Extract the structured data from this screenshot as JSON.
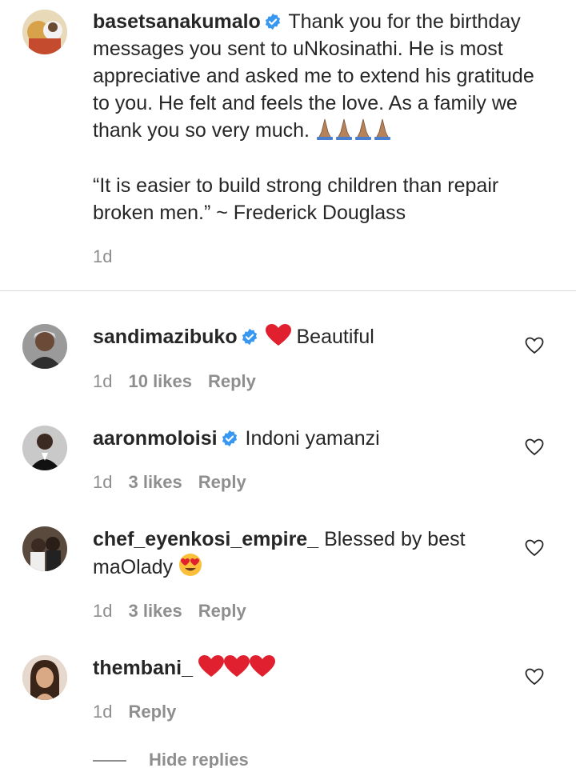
{
  "caption": {
    "username": "basetsanakumalo",
    "verified": true,
    "text": "Thank you for the birthday messages you sent to uNkosinathi. He is most appreciative and asked me to extend his gratitude to you. He felt and feels the love. As a family we thank you so very much.",
    "emoji": "praying-hands x4",
    "quote": "“It is easier to build strong children than repair broken men.” ~ Frederick Douglass",
    "time": "1d"
  },
  "comments": [
    {
      "username": "sandimazibuko",
      "verified": true,
      "emoji_prefix": "red-heart",
      "text": "Beautiful",
      "time": "1d",
      "likes": "10 likes",
      "reply": "Reply"
    },
    {
      "username": "aaronmoloisi",
      "verified": true,
      "text": "Indoni yamanzi",
      "time": "1d",
      "likes": "3 likes",
      "reply": "Reply"
    },
    {
      "username": "chef_eyenkosi_empire_",
      "verified": false,
      "text": "Blessed by best maOlady",
      "emoji_suffix": "heart-eyes",
      "time": "1d",
      "likes": "3 likes",
      "reply": "Reply"
    },
    {
      "username": "thembani_",
      "verified": false,
      "emoji_suffix": "red-heart x3",
      "time": "1d",
      "reply": "Reply"
    }
  ],
  "hide_replies": "Hide replies",
  "colors": {
    "text": "#262626",
    "muted": "#8e8e8e",
    "verified_blue": "#3897f0",
    "heart_red": "#ed4956",
    "divider": "#dbdbdb"
  }
}
